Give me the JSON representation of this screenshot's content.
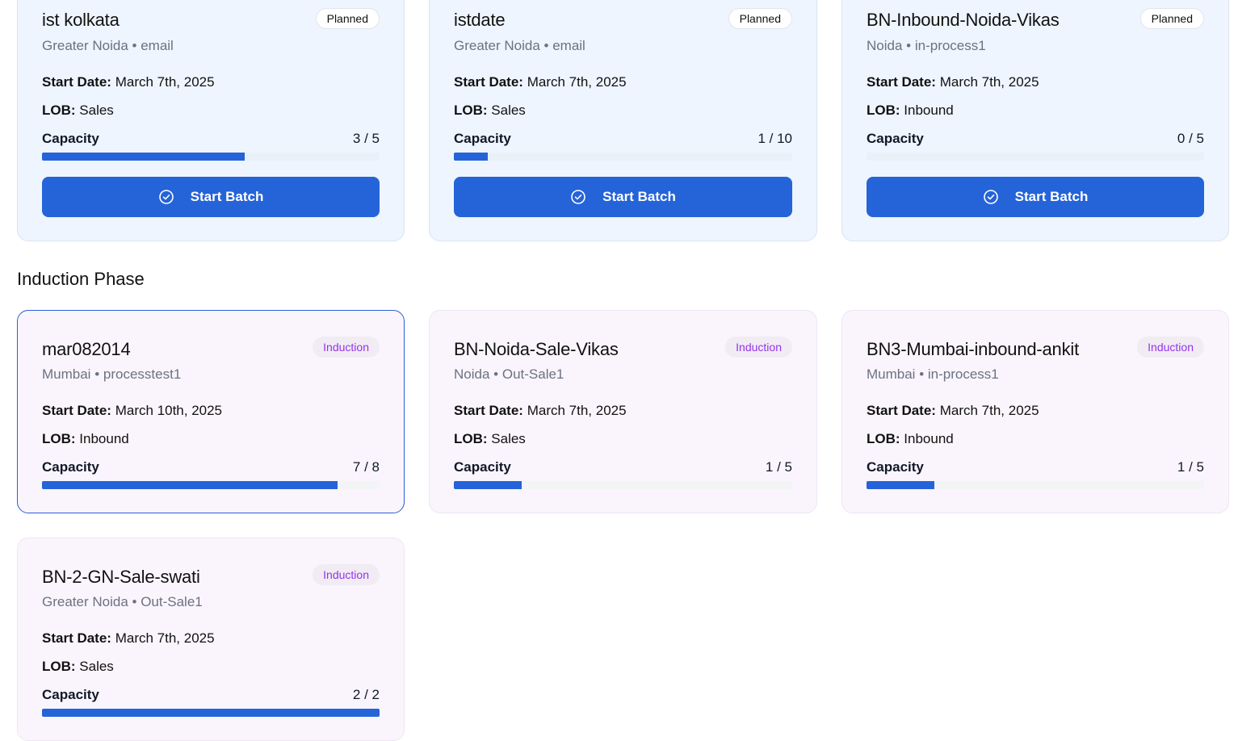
{
  "planned_batches": [
    {
      "name": "ist kolkata",
      "location": "Greater Noida",
      "process": "email",
      "status": "Planned",
      "start_date_label": "Start Date:",
      "start_date": "March 7th, 2025",
      "lob_label": "LOB:",
      "lob": "Sales",
      "capacity_label": "Capacity",
      "capacity_text": "3 / 5",
      "capacity_fraction": 0.6,
      "button_label": "Start Batch"
    },
    {
      "name": "istdate",
      "location": "Greater Noida",
      "process": "email",
      "status": "Planned",
      "start_date_label": "Start Date:",
      "start_date": "March 7th, 2025",
      "lob_label": "LOB:",
      "lob": "Sales",
      "capacity_label": "Capacity",
      "capacity_text": "1 / 10",
      "capacity_fraction": 0.1,
      "button_label": "Start Batch"
    },
    {
      "name": "BN-Inbound-Noida-Vikas",
      "location": "Noida",
      "process": "in-process1",
      "status": "Planned",
      "start_date_label": "Start Date:",
      "start_date": "March 7th, 2025",
      "lob_label": "LOB:",
      "lob": "Inbound",
      "capacity_label": "Capacity",
      "capacity_text": "0 / 5",
      "capacity_fraction": 0,
      "button_label": "Start Batch"
    }
  ],
  "induction_section_title": "Induction Phase",
  "induction_batches": [
    {
      "name": "mar082014",
      "location": "Mumbai",
      "process": "processtest1",
      "status": "Induction",
      "start_date_label": "Start Date:",
      "start_date": "March 10th, 2025",
      "lob_label": "LOB:",
      "lob": "Inbound",
      "capacity_label": "Capacity",
      "capacity_text": "7 / 8",
      "capacity_fraction": 0.875
    },
    {
      "name": "BN-Noida-Sale-Vikas",
      "location": "Noida",
      "process": "Out-Sale1",
      "status": "Induction",
      "start_date_label": "Start Date:",
      "start_date": "March 7th, 2025",
      "lob_label": "LOB:",
      "lob": "Sales",
      "capacity_label": "Capacity",
      "capacity_text": "1 / 5",
      "capacity_fraction": 0.2
    },
    {
      "name": "BN3-Mumbai-inbound-ankit",
      "location": "Mumbai",
      "process": "in-process1",
      "status": "Induction",
      "start_date_label": "Start Date:",
      "start_date": "March 7th, 2025",
      "lob_label": "LOB:",
      "lob": "Inbound",
      "capacity_label": "Capacity",
      "capacity_text": "1 / 5",
      "capacity_fraction": 0.2
    },
    {
      "name": "BN-2-GN-Sale-swati",
      "location": "Greater Noida",
      "process": "Out-Sale1",
      "status": "Induction",
      "start_date_label": "Start Date:",
      "start_date": "March 7th, 2025",
      "lob_label": "LOB:",
      "lob": "Sales",
      "capacity_label": "Capacity",
      "capacity_text": "2 / 2",
      "capacity_fraction": 1
    }
  ],
  "separator": "•",
  "icons": {
    "start_button": "check-circle-icon"
  },
  "colors": {
    "accent": "#2563d8",
    "induction_badge_text": "#9333ea",
    "planned_card_bg": "#eef5ff",
    "induction_card_bg": "#faf5fd"
  }
}
